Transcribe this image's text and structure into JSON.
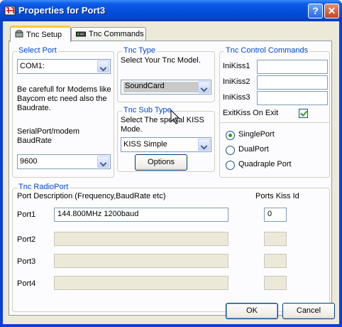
{
  "window": {
    "title": "Properties for Port3",
    "help_label": "?",
    "close_label": "✕"
  },
  "tabs": [
    {
      "label": "Tnc Setup"
    },
    {
      "label": "Tnc Commands"
    }
  ],
  "select_port": {
    "title": "Select Port",
    "port_value": "COM1:",
    "warning": [
      "Be carefull for Modems like",
      "Baycom etc need also the",
      "Baudrate."
    ],
    "baud_label": [
      "SerialPort/modem",
      "BaudRate"
    ],
    "baud_value": "9600"
  },
  "tnc_type": {
    "title": "Tnc Type",
    "prompt": "Select Your Tnc Model.",
    "value": "SoundCard"
  },
  "tnc_sub_type": {
    "title": "Tnc Sub Type",
    "prompt": [
      "Select The special KISS",
      "Mode."
    ],
    "value": "KISS Simple",
    "options_label": "Options"
  },
  "control_commands": {
    "title": "Tnc Control Commands",
    "fields": [
      {
        "label": "IniKiss1",
        "value": ""
      },
      {
        "label": "IniKiss2",
        "value": ""
      },
      {
        "label": "IniKiss3",
        "value": ""
      }
    ],
    "exit_kiss_label": "ExitKiss On Exit",
    "exit_kiss_checked": true,
    "radios": [
      {
        "label": "SinglePort",
        "selected": true
      },
      {
        "label": "DualPort",
        "selected": false
      },
      {
        "label": "Quadraple Port",
        "selected": false
      }
    ]
  },
  "radio_port": {
    "title": "Tnc RadioPort",
    "desc_header": "Port Description (Frequency,BaudRate etc)",
    "kiss_header": "Ports Kiss Id",
    "ports": [
      {
        "label": "Port1",
        "description": "144.800MHz 1200baud",
        "kiss_id": "0",
        "enabled": true
      },
      {
        "label": "Port2",
        "description": "",
        "kiss_id": "",
        "enabled": false
      },
      {
        "label": "Port3",
        "description": "",
        "kiss_id": "",
        "enabled": false
      },
      {
        "label": "Port4",
        "description": "",
        "kiss_id": "",
        "enabled": false
      }
    ]
  },
  "footer": {
    "ok_label": "OK",
    "cancel_label": "Cancel"
  }
}
